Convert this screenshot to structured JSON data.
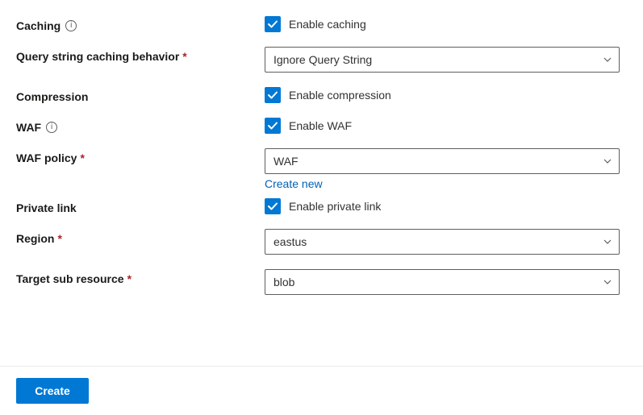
{
  "caching": {
    "label": "Caching",
    "checkbox_label": "Enable caching",
    "checked": true
  },
  "query_string": {
    "label": "Query string caching behavior",
    "required": true,
    "value": "Ignore Query String"
  },
  "compression": {
    "label": "Compression",
    "checkbox_label": "Enable compression",
    "checked": true
  },
  "waf": {
    "label": "WAF",
    "checkbox_label": "Enable WAF",
    "checked": true
  },
  "waf_policy": {
    "label": "WAF policy",
    "required": true,
    "value": "WAF",
    "create_new": "Create new"
  },
  "private_link": {
    "label": "Private link",
    "checkbox_label": "Enable private link",
    "checked": true
  },
  "region": {
    "label": "Region",
    "required": true,
    "value": "eastus"
  },
  "target_sub": {
    "label": "Target sub resource",
    "required": true,
    "value": "blob"
  },
  "footer": {
    "create": "Create"
  },
  "glyphs": {
    "info": "i"
  }
}
